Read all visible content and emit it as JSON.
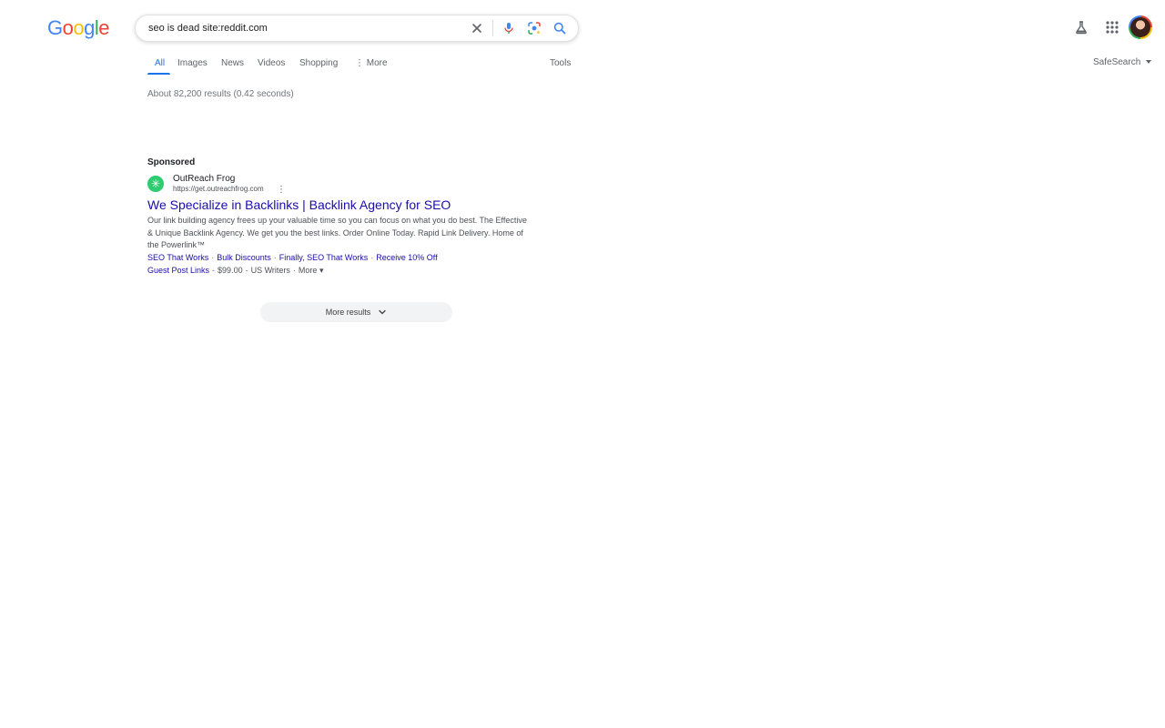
{
  "logo": {
    "letters": [
      "G",
      "o",
      "o",
      "g",
      "l",
      "e"
    ]
  },
  "search": {
    "value": "seo is dead site:reddit.com"
  },
  "tabs": [
    {
      "label": "All",
      "active": true
    },
    {
      "label": "Images"
    },
    {
      "label": "News"
    },
    {
      "label": "Videos"
    },
    {
      "label": "Shopping"
    },
    {
      "label": "More"
    }
  ],
  "tools_label": "Tools",
  "safesearch_label": "SafeSearch",
  "stats": "About 82,200 results (0.42 seconds)",
  "ad": {
    "sponsored_label": "Sponsored",
    "advertiser": "OutReach Frog",
    "url": "https://get.outreachfrog.com",
    "title": "We Specialize in Backlinks | Backlink Agency for SEO",
    "description": "Our link building agency frees up your valuable time so you can focus on what you do best. The Effective & Unique Backlink Agency. We get you the best links. Order Online Today. Rapid Link Delivery. Home of the Powerlink™",
    "sitelinks": [
      "SEO That Works",
      "Bulk Discounts",
      "Finally, SEO That Works",
      "Receive 10% Off"
    ],
    "extra": {
      "label": "Guest Post Links",
      "price": "$99.00",
      "note": "US Writers",
      "more": "More"
    }
  },
  "more_results_label": "More results",
  "colors": {
    "link": "#1a0dab",
    "accent": "#1a73e8"
  }
}
